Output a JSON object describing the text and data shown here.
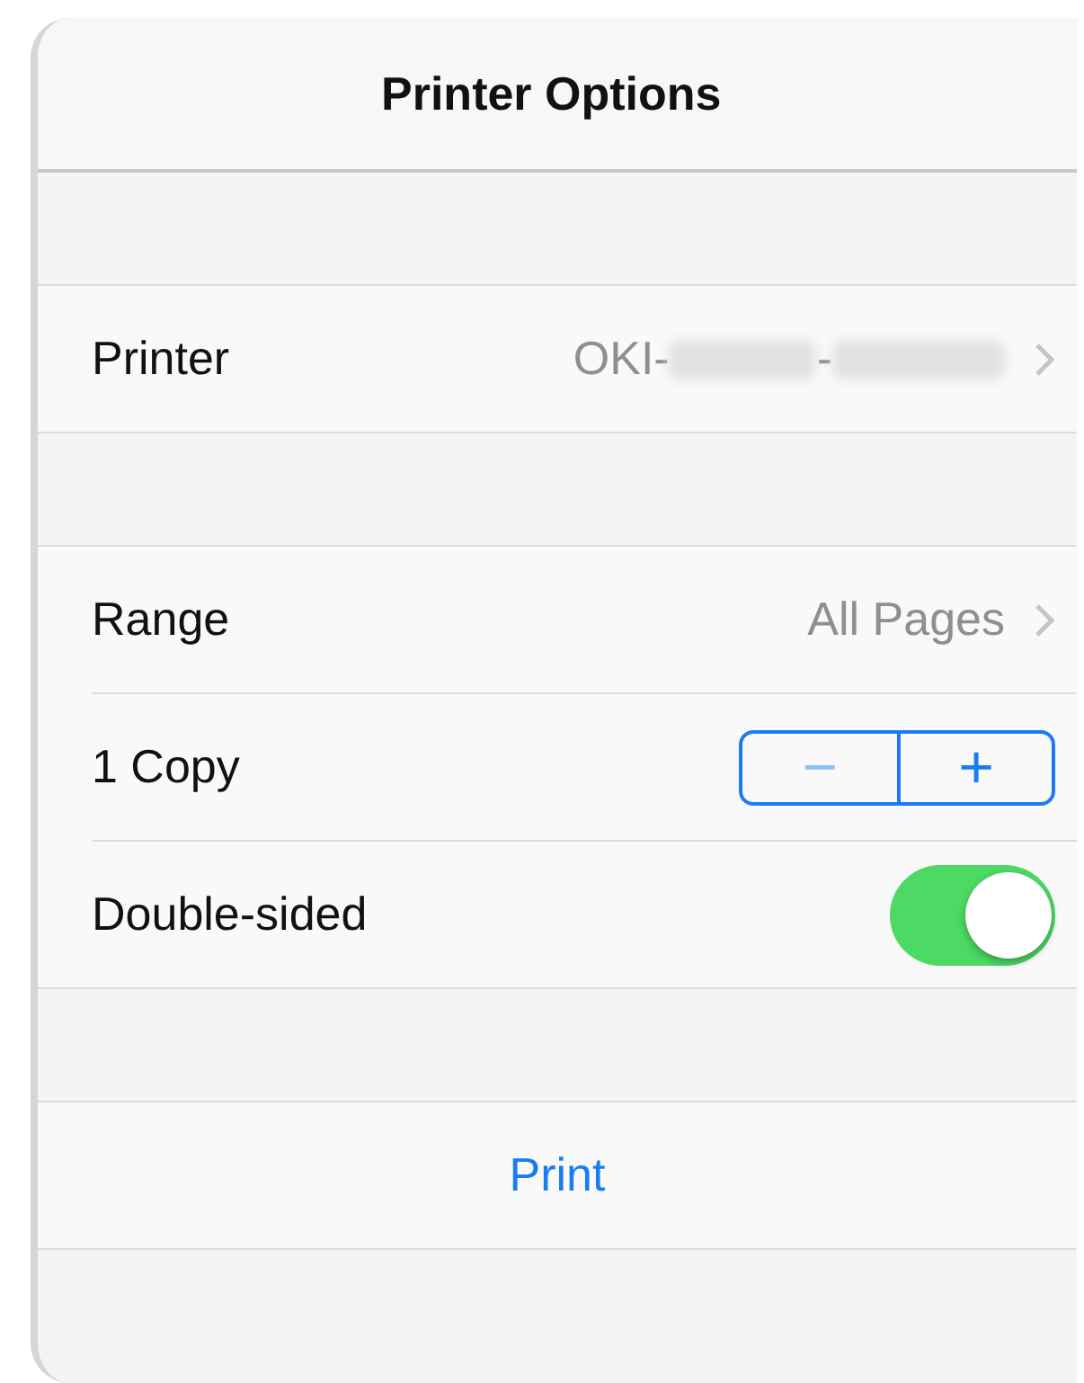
{
  "title": "Printer Options",
  "sections": [
    [
      {
        "kind": "disclosure",
        "label": "Printer",
        "value": "OKI-",
        "redacted": true,
        "value_2": "-"
      }
    ],
    [
      {
        "kind": "disclosure",
        "label": "Range",
        "value": "All Pages"
      },
      {
        "kind": "stepper",
        "label": "1 Copy",
        "minus": "−",
        "plus": "+",
        "minus_disabled": true,
        "plus_disabled": false
      },
      {
        "kind": "toggle",
        "label": "Double-sided",
        "on": true
      }
    ],
    [
      {
        "kind": "action",
        "label": "Print"
      }
    ]
  ]
}
